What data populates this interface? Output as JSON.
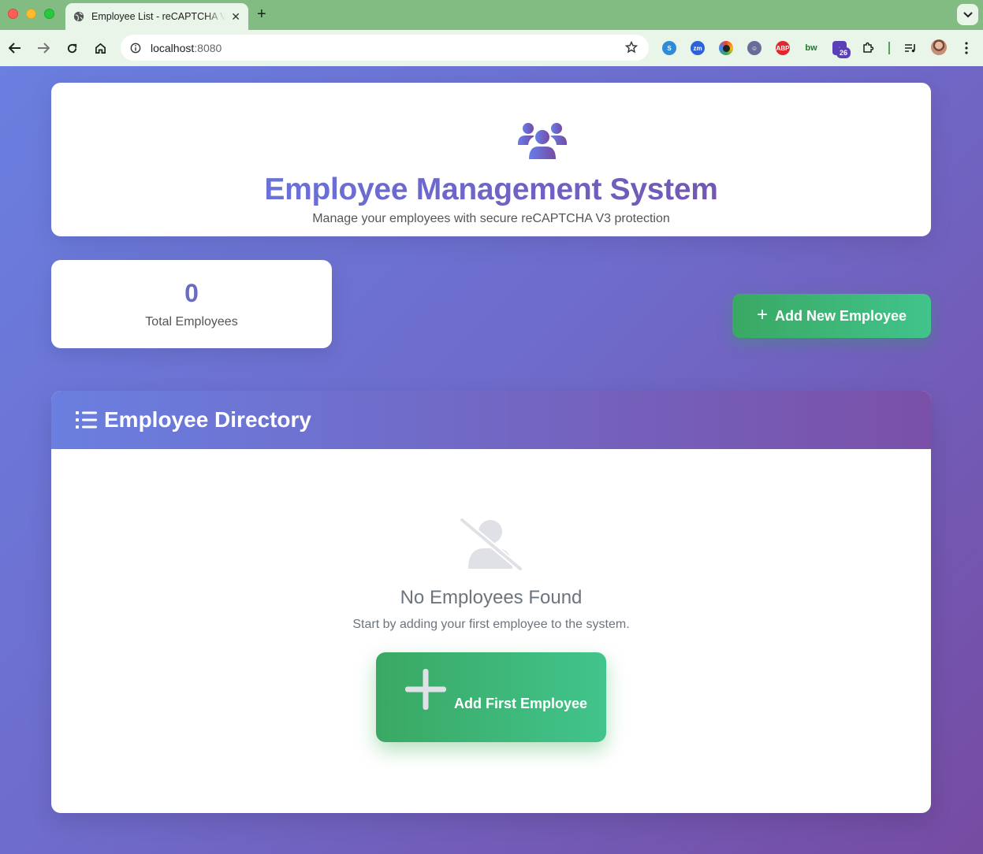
{
  "browser": {
    "tab_title": "Employee List - reCAPTCHA V3",
    "url_host": "localhost",
    "url_port": ":8080",
    "extension_badge": "26"
  },
  "header": {
    "title": "Employee Management System",
    "subtitle": "Manage your employees with secure reCAPTCHA V3 protection"
  },
  "stats": {
    "total_value": "0",
    "total_label": "Total Employees"
  },
  "actions": {
    "add_new_label": "Add New Employee"
  },
  "directory": {
    "title": "Employee Directory",
    "empty_title": "No Employees Found",
    "empty_desc": "Start by adding your first employee to the system.",
    "add_first_label": "Add First Employee"
  },
  "colors": {
    "gradient_start": "#667eea",
    "gradient_end": "#764ba2",
    "success": "#3aa863",
    "muted": "#6c757d"
  }
}
